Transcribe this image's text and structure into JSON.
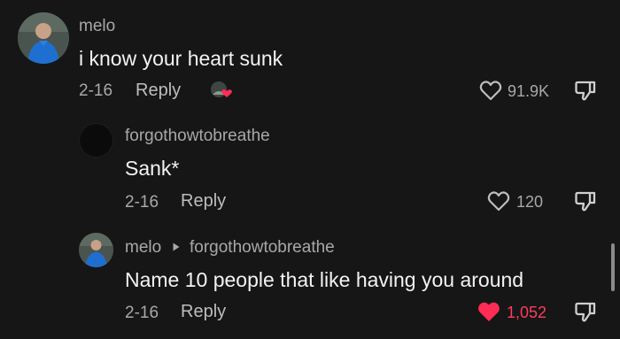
{
  "colors": {
    "background": "#161616",
    "text_primary": "#f3f3f3",
    "text_secondary": "#a8a8a8",
    "liked": "#ff3b5c"
  },
  "comments": [
    {
      "username": "melo",
      "text": "i know your heart sunk",
      "date": "2-16",
      "reply_label": "Reply",
      "likes": "91.9K",
      "liked": false,
      "icons": [
        "avatar",
        "reaction-avatar-heart",
        "heart-outline-icon",
        "dislike-icon"
      ]
    }
  ],
  "replies": [
    {
      "username": "forgothowtobreathe",
      "text": "Sank*",
      "date": "2-16",
      "reply_label": "Reply",
      "likes": "120",
      "liked": false
    },
    {
      "username": "melo",
      "reply_to": "forgothowtobreathe",
      "text": "Name 10 people that like having you around",
      "date": "2-16",
      "reply_label": "Reply",
      "likes": "1,052",
      "liked": true
    }
  ]
}
